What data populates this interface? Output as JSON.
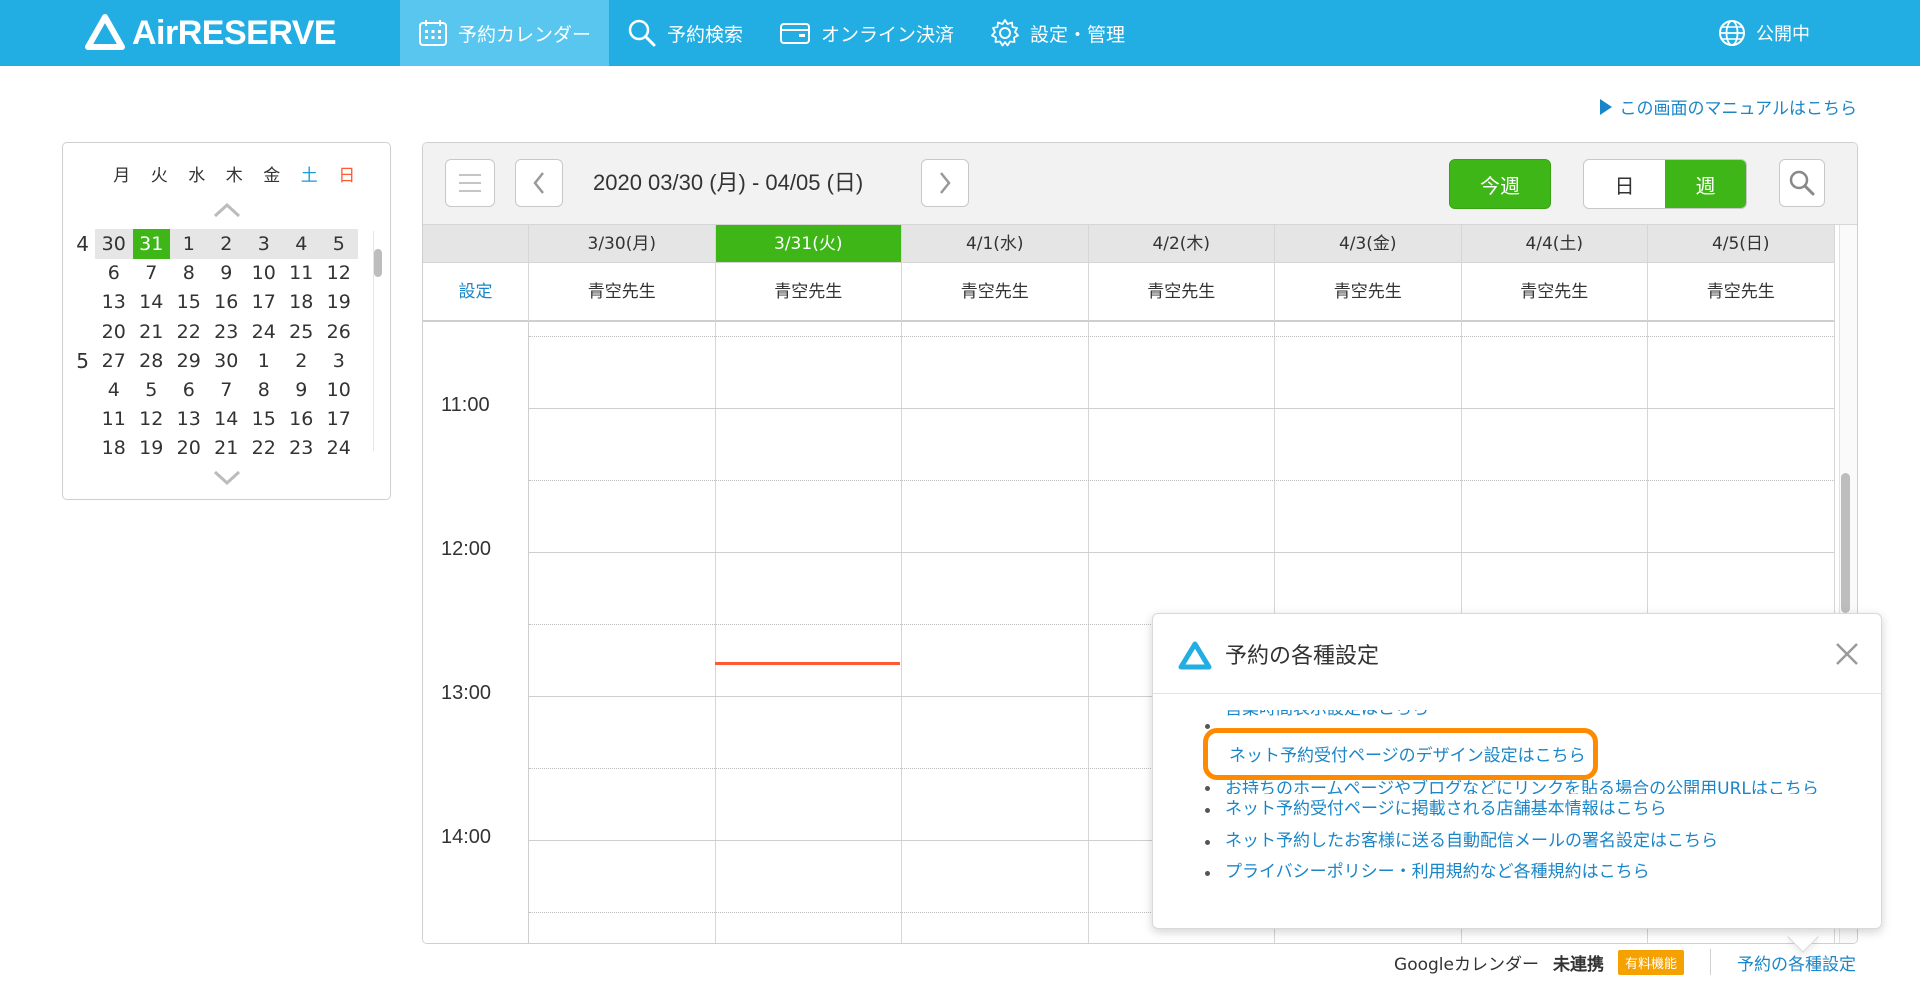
{
  "header": {
    "logo_text": "AirRESERVE",
    "nav": [
      {
        "label": "予約カレンダー",
        "icon": "calendar-icon",
        "active": true
      },
      {
        "label": "予約検索",
        "icon": "search-icon",
        "active": false
      },
      {
        "label": "オンライン決済",
        "icon": "wallet-icon",
        "active": false
      },
      {
        "label": "設定・管理",
        "icon": "gear-icon",
        "active": false
      }
    ],
    "status_label": "公開中",
    "accent_color": "#22ade3"
  },
  "manual_link": "この画面のマニュアルはこちら",
  "mini_calendar": {
    "weekdays": [
      "月",
      "火",
      "水",
      "木",
      "金",
      "土",
      "日"
    ],
    "rows": [
      {
        "month": "4",
        "days": [
          "30",
          "31",
          "1",
          "2",
          "3",
          "4",
          "5"
        ],
        "highlight": true
      },
      {
        "month": "",
        "days": [
          "6",
          "7",
          "8",
          "9",
          "10",
          "11",
          "12"
        ]
      },
      {
        "month": "",
        "days": [
          "13",
          "14",
          "15",
          "16",
          "17",
          "18",
          "19"
        ]
      },
      {
        "month": "",
        "days": [
          "20",
          "21",
          "22",
          "23",
          "24",
          "25",
          "26"
        ]
      },
      {
        "month": "5",
        "days": [
          "27",
          "28",
          "29",
          "30",
          "1",
          "2",
          "3"
        ]
      },
      {
        "month": "",
        "days": [
          "4",
          "5",
          "6",
          "7",
          "8",
          "9",
          "10"
        ]
      },
      {
        "month": "",
        "days": [
          "11",
          "12",
          "13",
          "14",
          "15",
          "16",
          "17"
        ]
      },
      {
        "month": "",
        "days": [
          "18",
          "19",
          "20",
          "21",
          "22",
          "23",
          "24"
        ]
      }
    ],
    "today": "31"
  },
  "calendar": {
    "date_range": "2020 03/30 (月) - 04/05 (日)",
    "this_week_label": "今週",
    "view_day_label": "日",
    "view_week_label": "週",
    "settings_label": "設定",
    "days": [
      {
        "label": "3/30(月)",
        "staff": "青空先生",
        "today": false
      },
      {
        "label": "3/31(火)",
        "staff": "青空先生",
        "today": true
      },
      {
        "label": "4/1(水)",
        "staff": "青空先生",
        "today": false
      },
      {
        "label": "4/2(木)",
        "staff": "青空先生",
        "today": false
      },
      {
        "label": "4/3(金)",
        "staff": "青空先生",
        "today": false
      },
      {
        "label": "4/4(土)",
        "staff": "青空先生",
        "today": false
      },
      {
        "label": "4/5(日)",
        "staff": "青空先生",
        "today": false
      }
    ],
    "times": [
      "11:00",
      "12:00",
      "13:00",
      "14:00"
    ],
    "today_color": "#3fb618",
    "now_line_color": "#ff5a32"
  },
  "footer": {
    "gcal_label": "Googleカレンダー",
    "gcal_status": "未連携",
    "paid_badge": "有料機能",
    "settings_link": "予約の各種設定"
  },
  "popover": {
    "title": "予約の各種設定",
    "links": [
      "営業時間表示設定はこちら",
      "ネット予約受付ページのデザイン設定はこちら",
      "お持ちのホームページやブログなどにリンクを貼る場合の公開用URLはこちら",
      "ネット予約受付ページに掲載される店舗基本情報はこちら",
      "ネット予約したお客様に送る自動配信メールの署名設定はこちら",
      "プライバシーポリシー・利用規約など各種規約はこちら"
    ],
    "highlight_color": "#ff8a00"
  }
}
